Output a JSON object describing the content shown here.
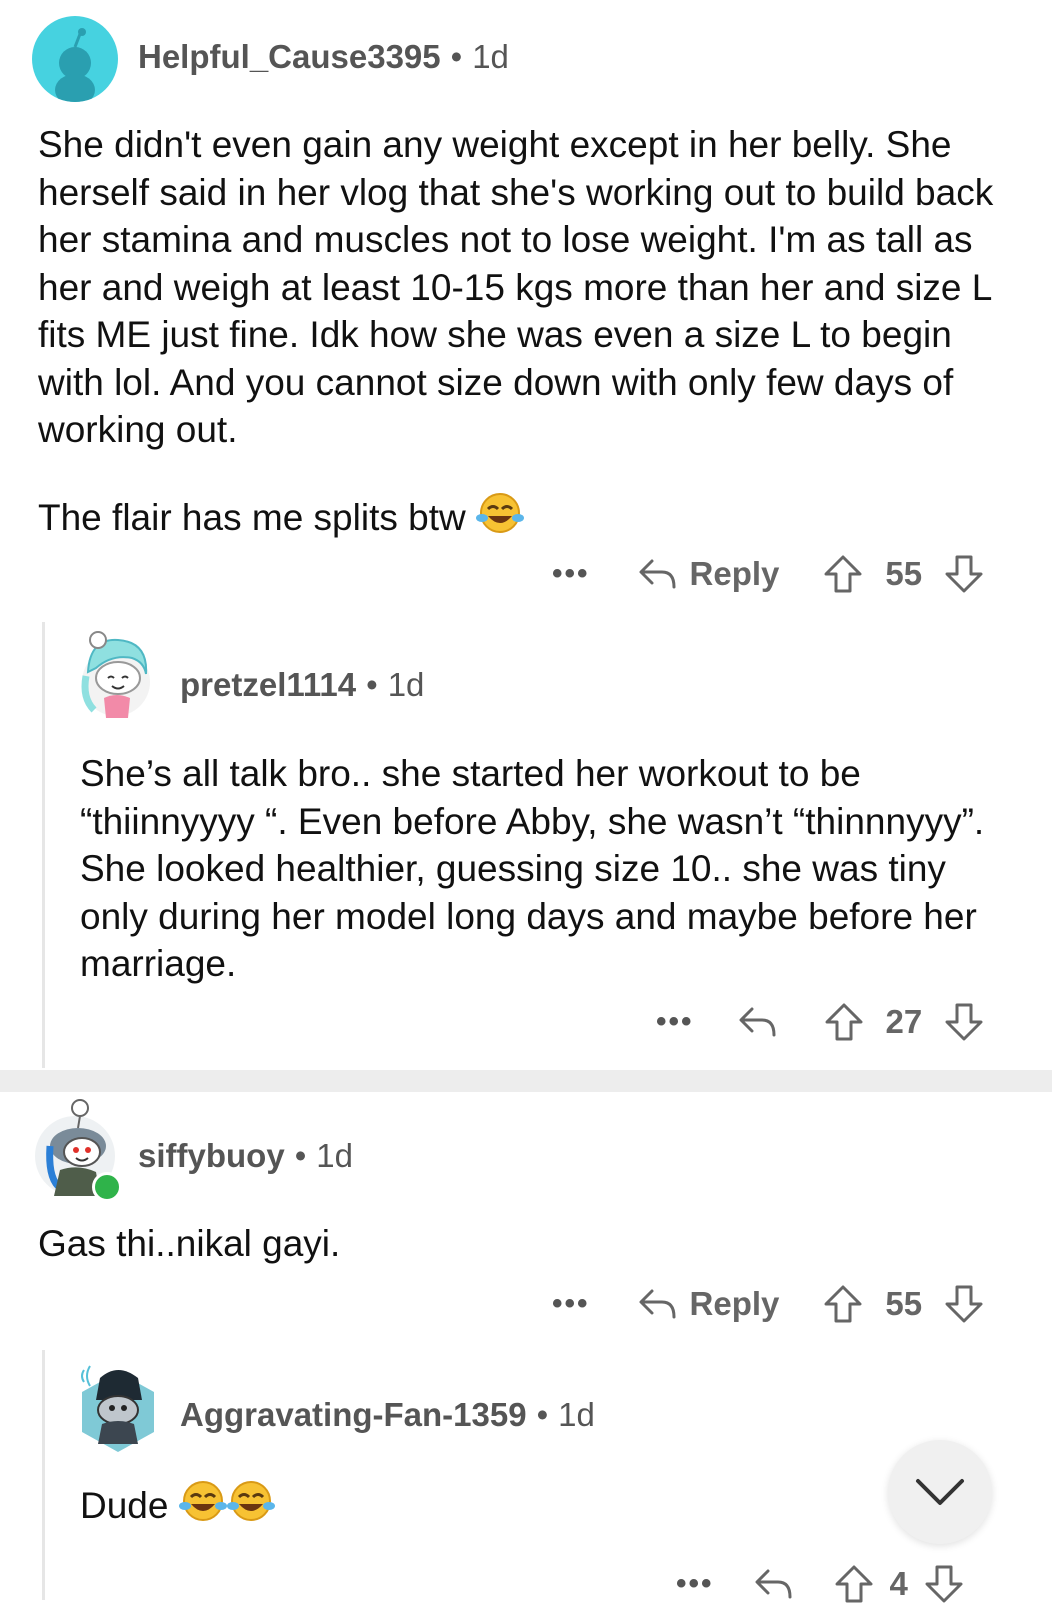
{
  "comments": [
    {
      "username": "Helpful_Cause3395",
      "separator": "•",
      "age": "1d",
      "paragraphs": [
        "She didn't even gain any weight except in her belly. She herself said in her vlog that she's working out to build back her stamina and muscles not to lose weight. I'm as tall as her and weigh at least 10-15 kgs more than her and size L fits ME just fine. Idk how she was even a size L to begin with lol. And you cannot size down with only few days of working out.",
        "The flair has me splits btw"
      ],
      "more": "•••",
      "reply_label": "Reply",
      "votes": "55"
    },
    {
      "username": "pretzel1114",
      "separator": "•",
      "age": "1d",
      "text": "She’s all talk bro.. she started her workout to be “thiinnyyyy “. Even before Abby, she wasn’t “thinnnyyy”. She looked healthier, guessing size 10.. she was tiny only during her model long days and maybe before her marriage.",
      "more": "•••",
      "votes": "27"
    },
    {
      "username": "siffybuoy",
      "separator": "•",
      "age": "1d",
      "text": "Gas thi..nikal gayi.",
      "more": "•••",
      "reply_label": "Reply",
      "votes": "55"
    },
    {
      "username": "Aggravating-Fan-1359",
      "separator": "•",
      "age": "1d",
      "text": "Dude",
      "more": "•••",
      "votes": "4"
    }
  ],
  "icons": {
    "emoji": "face-with-tears-of-joy",
    "reply": "reply-arrow-icon",
    "upvote": "upvote-arrow-icon",
    "downvote": "downvote-arrow-icon",
    "scroll": "chevron-down-icon"
  },
  "colors": {
    "avatar_teal": "#46d2e0",
    "online_dot": "#2fb34a",
    "muted_text": "#666666",
    "divider": "#ededed"
  }
}
